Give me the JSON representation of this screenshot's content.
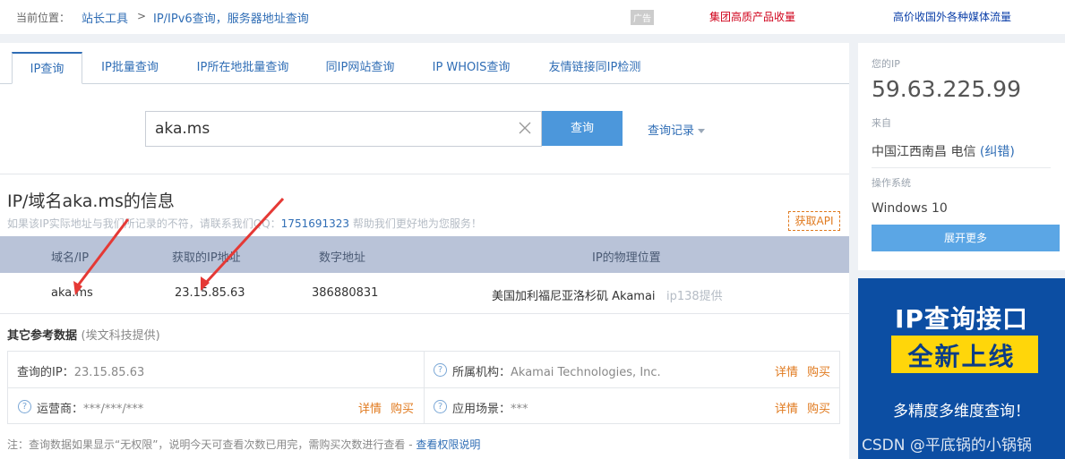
{
  "breadcrumb": {
    "label": "当前位置：",
    "items": [
      "站长工具",
      "IP/IPv6查询，服务器地址查询"
    ],
    "separator": ">"
  },
  "ads": {
    "tag": "广告",
    "link1": "集团高质产品收量",
    "link2": "高价收国外各种媒体流量"
  },
  "tabs": [
    {
      "label": "IP查询",
      "active": true
    },
    {
      "label": "IP批量查询"
    },
    {
      "label": "IP所在地批量查询"
    },
    {
      "label": "同IP网站查询"
    },
    {
      "label": "IP WHOIS查询"
    },
    {
      "label": "友情链接同IP检测"
    }
  ],
  "search": {
    "value": "aka.ms",
    "button": "查询",
    "history": "查询记录"
  },
  "info": {
    "title": "IP/域名aka.ms的信息",
    "note_prefix": "如果该IP实际地址与我们所记录的不符，请联系我们QQ：",
    "note_qq": "1751691323",
    "note_suffix": " 帮助我们更好地为您服务！",
    "api": "获取API"
  },
  "table": {
    "headers": [
      "域名/IP",
      "获取的IP地址",
      "数字地址",
      "IP的物理位置"
    ],
    "row": {
      "domain": "aka.ms",
      "ip": "23.15.85.63",
      "number": "386880831",
      "location": "美国加利福尼亚洛杉矶 Akamai",
      "provider": "ip138提供"
    }
  },
  "other": {
    "title": "其它参考数据",
    "subtitle": "(埃文科技提供)",
    "query_ip_label": "查询的IP：",
    "query_ip_value": "23.15.85.63",
    "org_label": "所属机构：",
    "org_value": "Akamai Technologies, Inc.",
    "isp_label": "运营商：",
    "isp_value": "***/***/***",
    "scene_label": "应用场景：",
    "scene_value": "***",
    "detail": "详情",
    "buy": "购买"
  },
  "footnote": {
    "text": "注：查询数据如果显示“无权限”，说明今天可查看次数已用完，需购买次数进行查看 - ",
    "link": "查看权限说明"
  },
  "side": {
    "your_ip_label": "您的IP",
    "your_ip": "59.63.225.99",
    "from_label": "来自",
    "from_value": "中国江西南昌 电信",
    "fix": "(纠错)",
    "os_label": "操作系统",
    "os_value": "Windows 10",
    "expand": "展开更多"
  },
  "promo": {
    "title": "IP查询接口",
    "subtitle": "全新上线",
    "desc": "多精度多维度查询！",
    "watermark": "CSDN @平底锅的小锅锅"
  },
  "colors": {
    "accent": "#2f6db5",
    "button": "#4c97db",
    "table_header": "#b9c3d8",
    "orange": "#e07a1f",
    "ad_red": "#d0021b",
    "promo_bg": "#0c4ea3",
    "promo_yellow": "#ffd60a",
    "arrow_red": "#e53935"
  }
}
